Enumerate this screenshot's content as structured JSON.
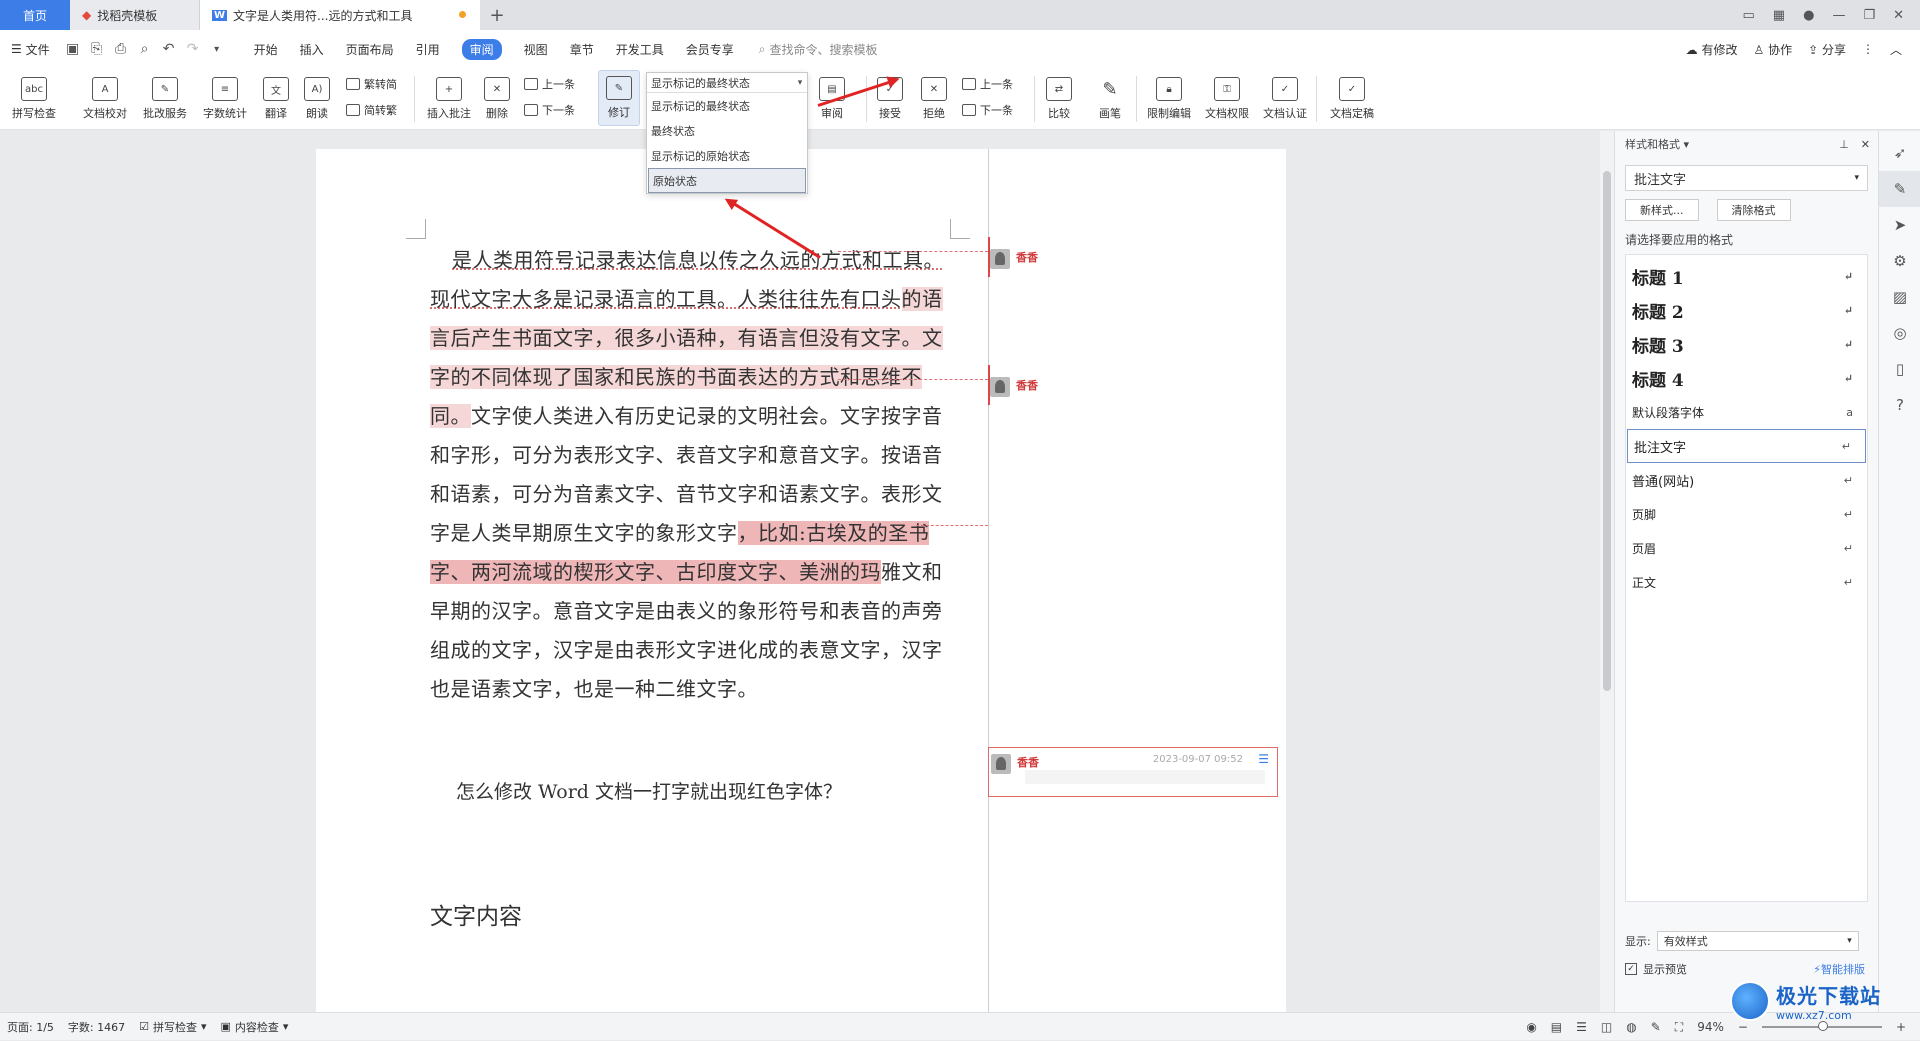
{
  "tabs": {
    "home": "首页",
    "template": "找稻壳模板",
    "document": "文字是人类用符...远的方式和工具"
  },
  "menubar": {
    "file": "文件",
    "items": [
      "开始",
      "插入",
      "页面布局",
      "引用",
      "审阅",
      "视图",
      "章节",
      "开发工具",
      "会员专享"
    ],
    "active": "审阅",
    "search_placeholder": "查找命令、搜索模板",
    "right": {
      "revise": "有修改",
      "collab": "协作",
      "share": "分享"
    }
  },
  "ribbon": {
    "spell": "拼写检查",
    "proof": "文档校对",
    "batch": "批改服务",
    "wordcount": "字数统计",
    "translate": "翻译",
    "read": "朗读",
    "trad": "繁转简",
    "simp": "简转繁",
    "insert_comment": "插入批注",
    "delete": "删除",
    "prev": "上一条",
    "next": "下一条",
    "track": "修订",
    "review_pane": "审阅",
    "accept": "接受",
    "reject": "拒绝",
    "prev2": "上一条",
    "next2": "下一条",
    "compare": "比较",
    "pen": "画笔",
    "restrict": "限制编辑",
    "rights": "文档权限",
    "certify": "文档认证",
    "finalize": "文档定稿"
  },
  "dropdown": {
    "current": "显示标记的最终状态",
    "options": [
      "显示标记的最终状态",
      "最终状态",
      "显示标记的原始状态",
      "原始状态"
    ],
    "highlighted": "原始状态"
  },
  "document": {
    "paragraph_seg1": "是人类用符号记录表达信息以传之久远的方式和工具。现代文字大多是记录语言的工具。人类往往先有口头",
    "paragraph_seg2": "的语言后产生书面文字，很多小语种，有语言但没有文字。文字的不同体现了国家和民族的书面表达的方式和思维不同。",
    "paragraph_seg3": "文字使人类进入有历史记录的文明社会。文字按字音和字形，可分为表形文字、表音文字和意音文字。按语音和语素，可分为音素文字、音节文字和语素文字。表形文字是人类早期原生文字的象形文字",
    "paragraph_seg4": "，比如:古埃及的圣书字、两河流域的楔形文字、古印度文字、美洲的玛",
    "paragraph_seg5": "雅文和早期的汉字。意音文字是由表义的象形符号和表音的声旁组成的文字，汉字是由表形文字进化成的表意文字，汉字也是语素文字，也是一种二维文字。",
    "question": "怎么修改 Word 文档一打字就出现红色字体？",
    "heading": "文字内容"
  },
  "comments": [
    {
      "author": "香香"
    },
    {
      "author": "香香"
    },
    {
      "author": "香香",
      "date": "2023-09-07 09:52"
    }
  ],
  "panel": {
    "title": "样式和格式",
    "current_style": "批注文字",
    "new_style": "新样式...",
    "clear_format": "清除格式",
    "choose_label": "请选择要应用的格式",
    "styles": [
      "标题 1",
      "标题 2",
      "标题 3",
      "标题 4",
      "默认段落字体",
      "批注文字",
      "普通(网站)",
      "页脚",
      "页眉",
      "正文"
    ],
    "show_label": "显示:",
    "show_value": "有效样式",
    "preview_label": "显示预览",
    "smart": "智能排版"
  },
  "status": {
    "page": "页面: 1/5",
    "words": "字数: 1467",
    "spell": "拼写检查",
    "content": "内容检查",
    "zoom": "94%"
  },
  "watermark": {
    "title": "极光下载站",
    "url": "www.xz7.com"
  },
  "colors": {
    "accent": "#3d7de8",
    "comment": "#d94848",
    "highlight_light": "#f6d7d7",
    "highlight_dark": "#efb6b8",
    "arrow": "#e02424"
  }
}
